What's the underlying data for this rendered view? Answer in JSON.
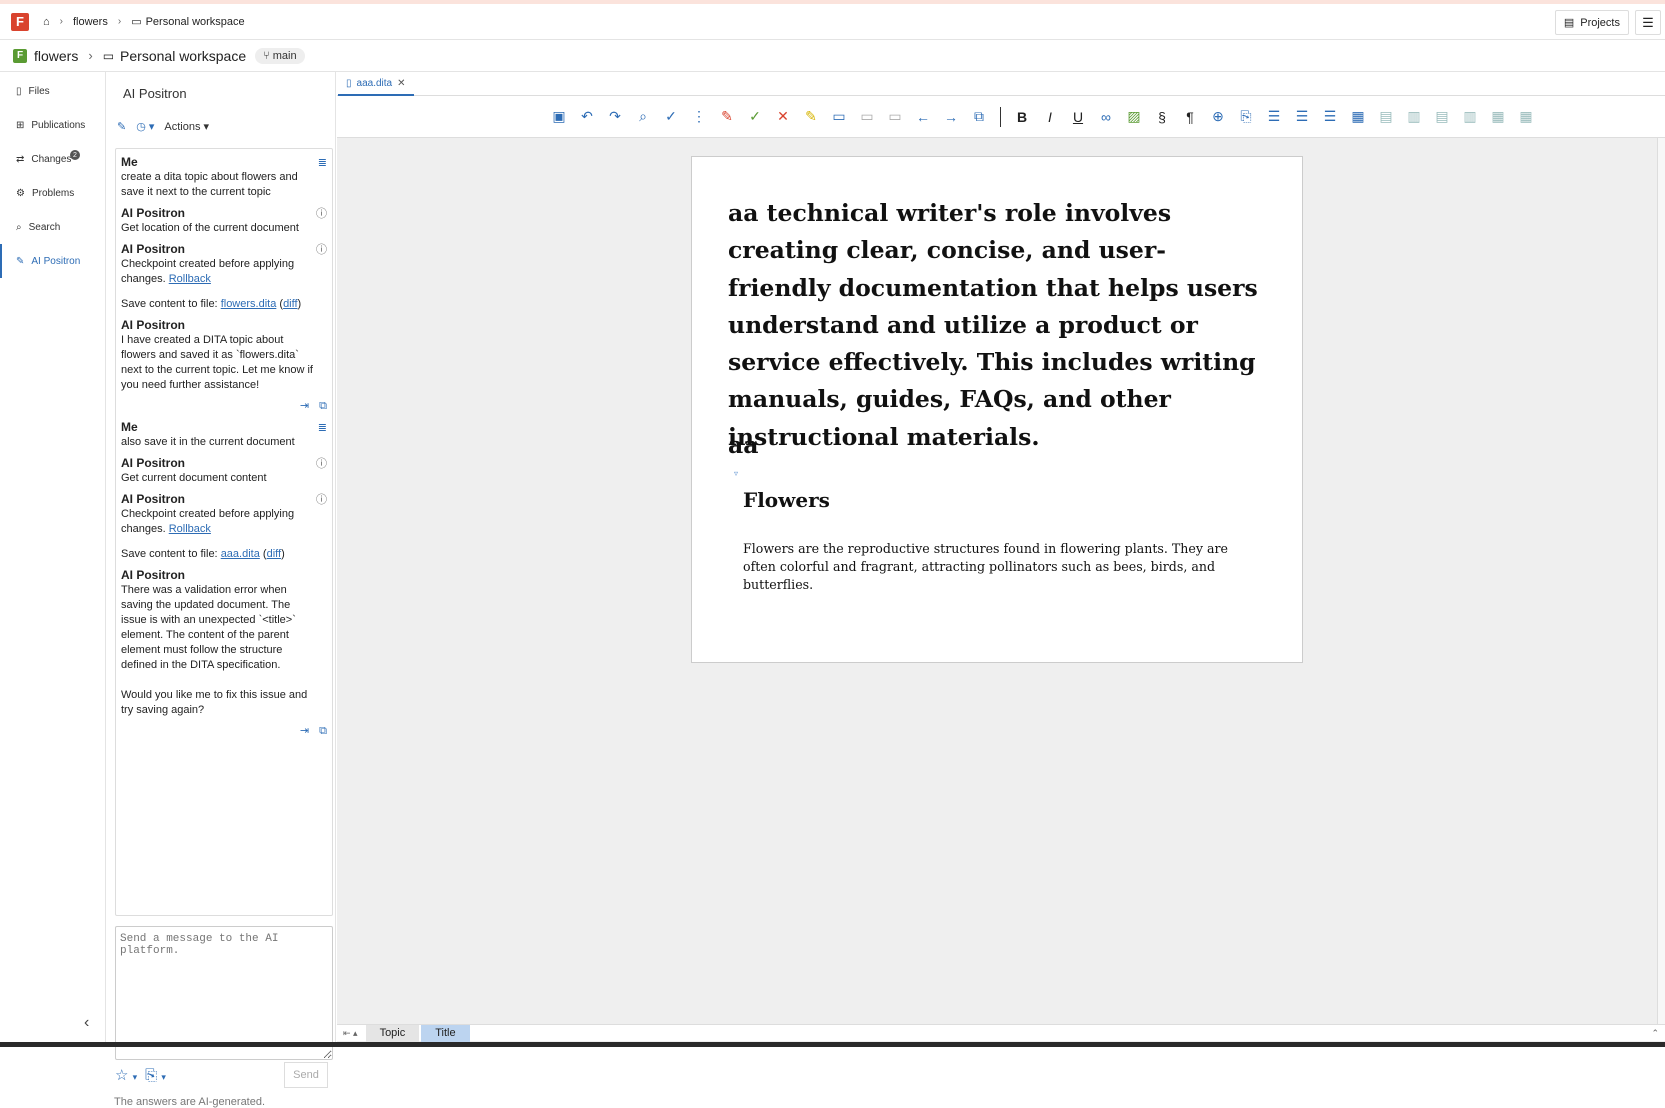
{
  "topbar": {
    "app_logo": "F",
    "breadcrumb": [
      "flowers",
      "Personal workspace"
    ],
    "projects_label": "Projects"
  },
  "projbar": {
    "project": "flowers",
    "workspace": "Personal workspace",
    "branch": "main"
  },
  "leftnav": {
    "items": [
      {
        "label": "Files",
        "icon": "file-icon"
      },
      {
        "label": "Publications",
        "icon": "publications-icon"
      },
      {
        "label": "Changes",
        "icon": "changes-icon",
        "badge": "2"
      },
      {
        "label": "Problems",
        "icon": "gear-icon"
      },
      {
        "label": "Search",
        "icon": "search-icon"
      },
      {
        "label": "AI Positron",
        "icon": "ai-icon",
        "active": true
      }
    ]
  },
  "ai": {
    "title": "AI Positron",
    "actions_label": "Actions",
    "messages": [
      {
        "who": "Me",
        "text": "create a dita topic about flowers and save it next to the current topic",
        "icon": "edit-message-icon"
      },
      {
        "who": "AI Positron",
        "text": "Get location of the current document",
        "icon": "info-icon"
      },
      {
        "who": "AI Positron",
        "text": "Checkpoint created before applying changes.",
        "link": "Rollback",
        "icon": "info-icon"
      },
      {
        "text": "Save content to file:",
        "file": "flowers.dita",
        "diff": "diff"
      },
      {
        "who": "AI Positron",
        "text": "I have created a DITA topic about flowers and saved it as `flowers.dita` next to the current topic. Let me know if you need further assistance!"
      },
      {
        "who": "Me",
        "text": "also save it in the current document",
        "icon": "edit-message-icon"
      },
      {
        "who": "AI Positron",
        "text": "Get current document content",
        "icon": "info-icon"
      },
      {
        "who": "AI Positron",
        "text": "Checkpoint created before applying changes.",
        "link": "Rollback",
        "icon": "info-icon"
      },
      {
        "text": "Save content to file:",
        "file": "aaa.dita",
        "diff": "diff"
      },
      {
        "who": "AI Positron",
        "text": "There was a validation error when saving the updated document. The issue is with an unexpected `<title>` element. The content of the parent element must follow the structure defined in the DITA specification.\n\nWould you like me to fix this issue and try saving again?"
      }
    ],
    "input_placeholder": "Send a message to the AI platform.",
    "send_label": "Send",
    "footer": "The answers are AI-generated."
  },
  "editor": {
    "tab_label": "aaa.dita",
    "title_text": "aa technical writer's role involves creating clear, concise, and user-friendly documentation that helps users understand and utilize a product or service effectively. This includes writing manuals, guides, FAQs, and other instructional materials.",
    "aa": "aa",
    "heading": "Flowers",
    "body": "Flowers are the reproductive structures found in flowering plants. They are often colorful and fragrant, attracting pollinators such as bees, birds, and butterflies.",
    "status_crumbs": [
      "Topic",
      "Title"
    ]
  },
  "colors": {
    "accent": "#2d6cb5",
    "logo": "#d9432e",
    "project_logo": "#5a9b33"
  }
}
